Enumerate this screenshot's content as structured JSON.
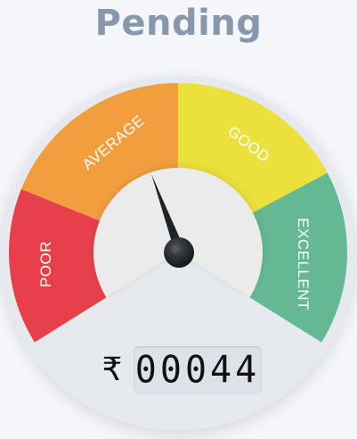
{
  "status": {
    "title": "Pending"
  },
  "gauge": {
    "labels": {
      "poor": "POOR",
      "average": "AVERAGE",
      "good": "GOOD",
      "excellent": "EXCELLENT"
    },
    "colors": {
      "poor": "#e8404a",
      "average": "#f19e3f",
      "good": "#ece03c",
      "excellent": "#64b893",
      "inner": "#ebebeb",
      "bezel": "#e6e9ee",
      "needle": "#1f2327"
    },
    "needle_icon": "gauge-needle"
  },
  "meter": {
    "currency_symbol": "₹",
    "value": "00044"
  }
}
